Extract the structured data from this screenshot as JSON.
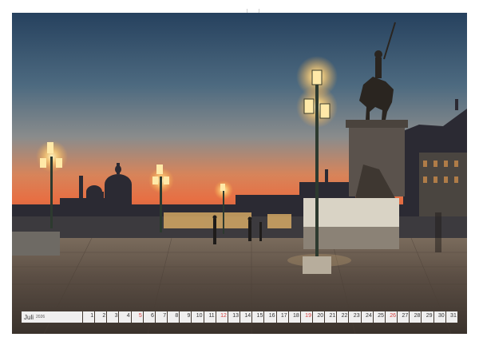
{
  "calendar": {
    "month": "Juli",
    "year": "2026",
    "days": [
      "1",
      "2",
      "3",
      "4",
      "5",
      "6",
      "7",
      "8",
      "9",
      "10",
      "11",
      "12",
      "13",
      "14",
      "15",
      "16",
      "17",
      "18",
      "19",
      "20",
      "21",
      "22",
      "23",
      "24",
      "25",
      "26",
      "27",
      "28",
      "29",
      "30",
      "31"
    ],
    "sunday_color": "#d43c3c"
  },
  "photo": {
    "subject": "Venice waterfront at dusk with lit street lamps, equestrian statue and Santa Maria della Salute dome",
    "sky_top": "#2f4e6b",
    "sky_horizon": "#e8774a",
    "lamp_glow": "#ffd27a"
  }
}
